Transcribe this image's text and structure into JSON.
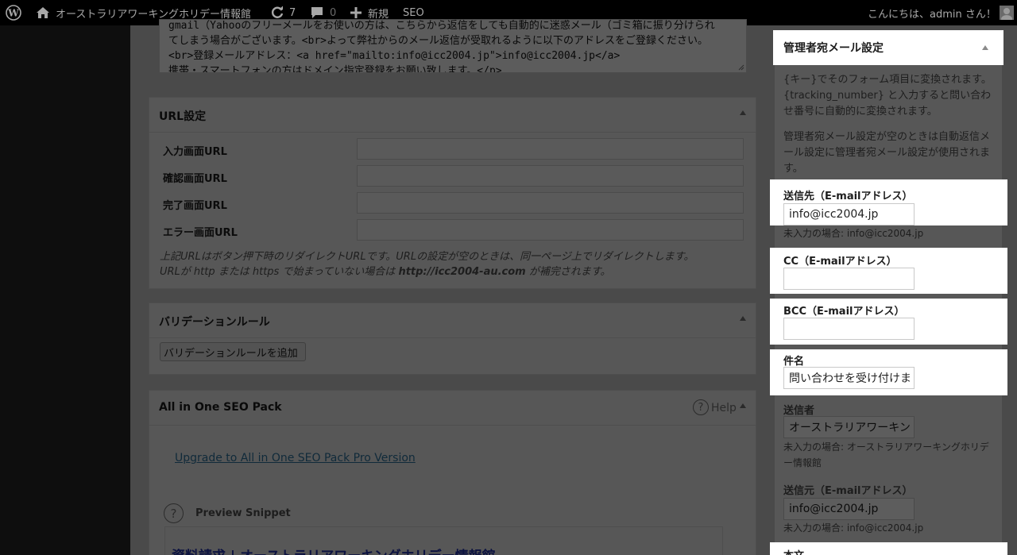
{
  "adminbar": {
    "site_name": "オーストラリアワーキングホリデー情報館",
    "updates_count": "7",
    "comments_count": "0",
    "new_label": "新規",
    "seo_label": "SEO",
    "greeting": "こんにちは、admin さん！"
  },
  "textarea_lines": [
    "gmail（Yahooのフリーメールをお使いの方は、こちらから返信をしても自動的に迷惑メール（ゴミ箱に振り分けられ",
    "てしまう場合がございます。<br>よって弊社からのメール返信が受取れるように以下のアドレスをご登録ください。",
    "<br>登録メールアドレス：<a href=\"mailto:info@icc2004.jp\">info@icc2004.jp</a>",
    "携帯・スマートフォンの方はドメイン指定登録をお願い致します。</p>"
  ],
  "url_box": {
    "title": "URL設定",
    "fields": [
      "入力画面URL",
      "確認画面URL",
      "完了画面URL",
      "エラー画面URL"
    ],
    "note_line1": "上記URLはボタン押下時のリダイレクトURLです。URLの設定が空のときは、同一ページ上でリダイレクトします。",
    "note_line2_pre": "URLが http または https で始まっていない場合は ",
    "note_line2_url": "http://icc2004-au.com",
    "note_line2_post": " が補完されます。"
  },
  "validation_box": {
    "title": "バリデーションルール",
    "add_button": "バリデーションルールを追加"
  },
  "seo_box": {
    "title": "All in One SEO Pack",
    "help_label": "Help",
    "upgrade_link": "Upgrade to All in One SEO Pack Pro Version",
    "preview_label": "Preview Snippet",
    "snippet_title": "資料請求 | オーストラリアワーキングホリデー情報館"
  },
  "admin_mail": {
    "title": "管理者宛メール設定",
    "desc1": "{キー}でそのフォーム項目に変換されます。 {tracking_number} と入力すると問い合わせ番号に自動的に変換されます。",
    "desc2": "管理者宛メール設定が空のときは自動返信メール設定に管理者宛メール設定が使用されます。",
    "to_label": "送信先（E-mailアドレス）",
    "to_value": "info@icc2004.jp",
    "to_hint": "未入力の場合: info@icc2004.jp",
    "cc_label": "CC（E-mailアドレス）",
    "cc_value": "",
    "bcc_label": "BCC（E-mailアドレス）",
    "bcc_value": "",
    "subject_label": "件名",
    "subject_value": "問い合わせを受け付けま",
    "sender_label": "送信者",
    "sender_value": "オーストラリアワーキン",
    "sender_hint": "未入力の場合: オーストラリアワーキングホリデー情報館",
    "from_label": "送信元（E-mailアドレス）",
    "from_value": "info@icc2004.jp",
    "from_hint": "未入力の場合: info@icc2004.jp",
    "body_label": "本文"
  }
}
